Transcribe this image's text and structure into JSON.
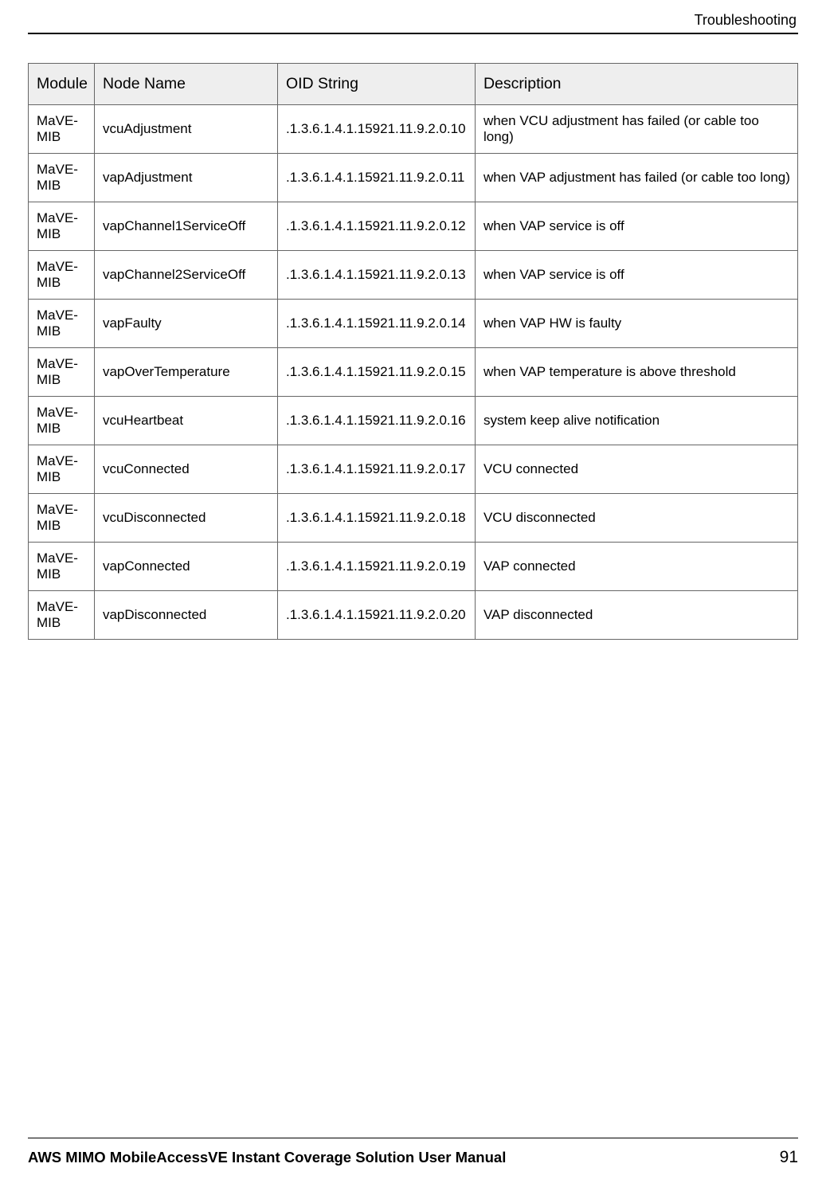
{
  "header": {
    "section": "Troubleshooting"
  },
  "table": {
    "headers": {
      "module": "Module",
      "node": "Node Name",
      "oid": "OID String",
      "desc": "Description"
    },
    "rows": [
      {
        "module": "MaVE-MIB",
        "node": "vcuAdjustment",
        "oid": ".1.3.6.1.4.1.15921.11.9.2.0.10",
        "desc": "when VCU adjustment has failed (or cable too long)"
      },
      {
        "module": "MaVE-MIB",
        "node": "vapAdjustment",
        "oid": ".1.3.6.1.4.1.15921.11.9.2.0.11",
        "desc": "when VAP adjustment has failed (or cable too long)"
      },
      {
        "module": "MaVE-MIB",
        "node": "vapChannel1ServiceOff",
        "oid": ".1.3.6.1.4.1.15921.11.9.2.0.12",
        "desc": "when VAP service is off"
      },
      {
        "module": "MaVE-MIB",
        "node": "vapChannel2ServiceOff",
        "oid": ".1.3.6.1.4.1.15921.11.9.2.0.13",
        "desc": "when VAP service is off"
      },
      {
        "module": "MaVE-MIB",
        "node": "vapFaulty",
        "oid": ".1.3.6.1.4.1.15921.11.9.2.0.14",
        "desc": "when VAP HW is faulty"
      },
      {
        "module": "MaVE-MIB",
        "node": "vapOverTemperature",
        "oid": ".1.3.6.1.4.1.15921.11.9.2.0.15",
        "desc": "when VAP temperature is above threshold"
      },
      {
        "module": "MaVE-MIB",
        "node": "vcuHeartbeat",
        "oid": ".1.3.6.1.4.1.15921.11.9.2.0.16",
        "desc": "system keep alive notification"
      },
      {
        "module": "MaVE-MIB",
        "node": "vcuConnected",
        "oid": ".1.3.6.1.4.1.15921.11.9.2.0.17",
        "desc": "VCU connected"
      },
      {
        "module": "MaVE-MIB",
        "node": "vcuDisconnected",
        "oid": ".1.3.6.1.4.1.15921.11.9.2.0.18",
        "desc": "VCU disconnected"
      },
      {
        "module": "MaVE-MIB",
        "node": "vapConnected",
        "oid": ".1.3.6.1.4.1.15921.11.9.2.0.19",
        "desc": "VAP connected"
      },
      {
        "module": "MaVE-MIB",
        "node": "vapDisconnected",
        "oid": ".1.3.6.1.4.1.15921.11.9.2.0.20",
        "desc": "VAP disconnected"
      }
    ]
  },
  "footer": {
    "title": "AWS MIMO MobileAccessVE Instant Coverage Solution User Manual",
    "page": "91"
  }
}
